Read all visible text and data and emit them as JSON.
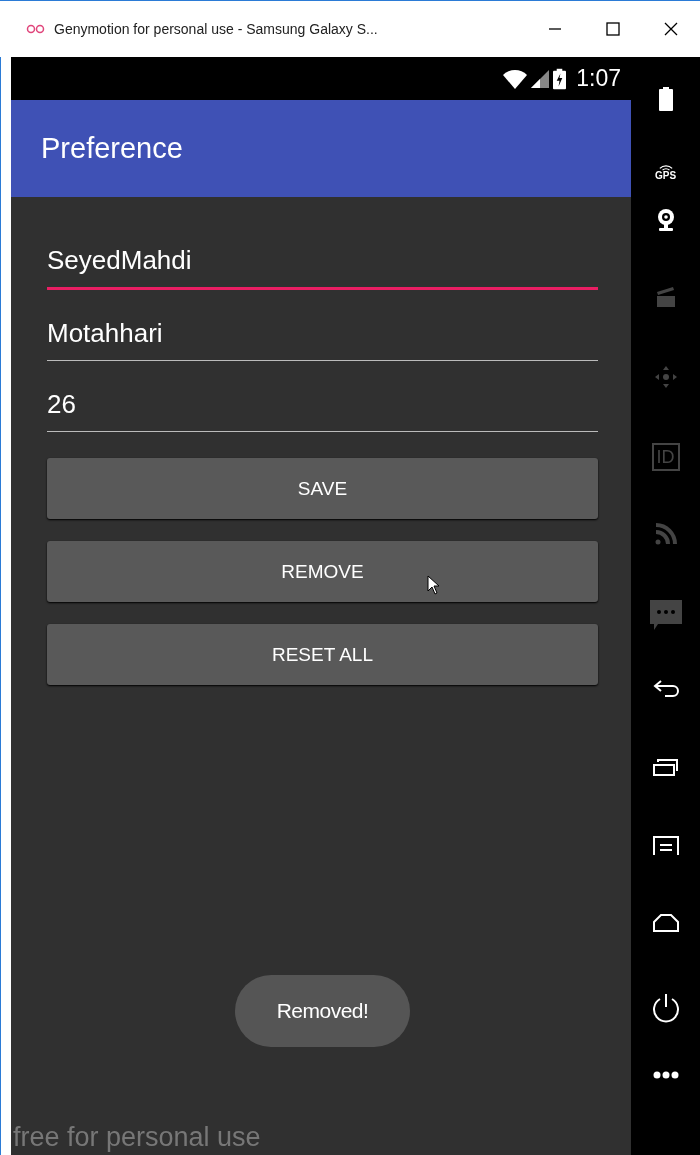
{
  "window": {
    "title": "Genymotion for personal use - Samsung Galaxy S..."
  },
  "status_bar": {
    "time": "1:07"
  },
  "app_bar": {
    "title": "Preference"
  },
  "fields": [
    {
      "value": "SeyedMahdi",
      "focused": true
    },
    {
      "value": "Motahhari",
      "focused": false
    },
    {
      "value": "26",
      "focused": false
    }
  ],
  "buttons": [
    "SAVE",
    "REMOVE",
    "RESET ALL"
  ],
  "toast": "Removed!",
  "overlay_text": "free for personal use",
  "sidebar": [
    {
      "kind": "battery",
      "disabled": false
    },
    {
      "kind": "gps",
      "label": "GPS",
      "disabled": false
    },
    {
      "kind": "webcam",
      "disabled": false
    },
    {
      "kind": "clapper",
      "disabled": true
    },
    {
      "kind": "dpad",
      "disabled": true
    },
    {
      "kind": "id",
      "label": "ID",
      "disabled": true
    },
    {
      "kind": "rss",
      "disabled": true
    },
    {
      "kind": "sms",
      "disabled": true
    },
    {
      "kind": "back",
      "disabled": false
    },
    {
      "kind": "recent",
      "disabled": false
    },
    {
      "kind": "menu",
      "disabled": false
    },
    {
      "kind": "home",
      "disabled": false
    },
    {
      "kind": "power",
      "disabled": false
    },
    {
      "kind": "more",
      "disabled": false
    }
  ]
}
